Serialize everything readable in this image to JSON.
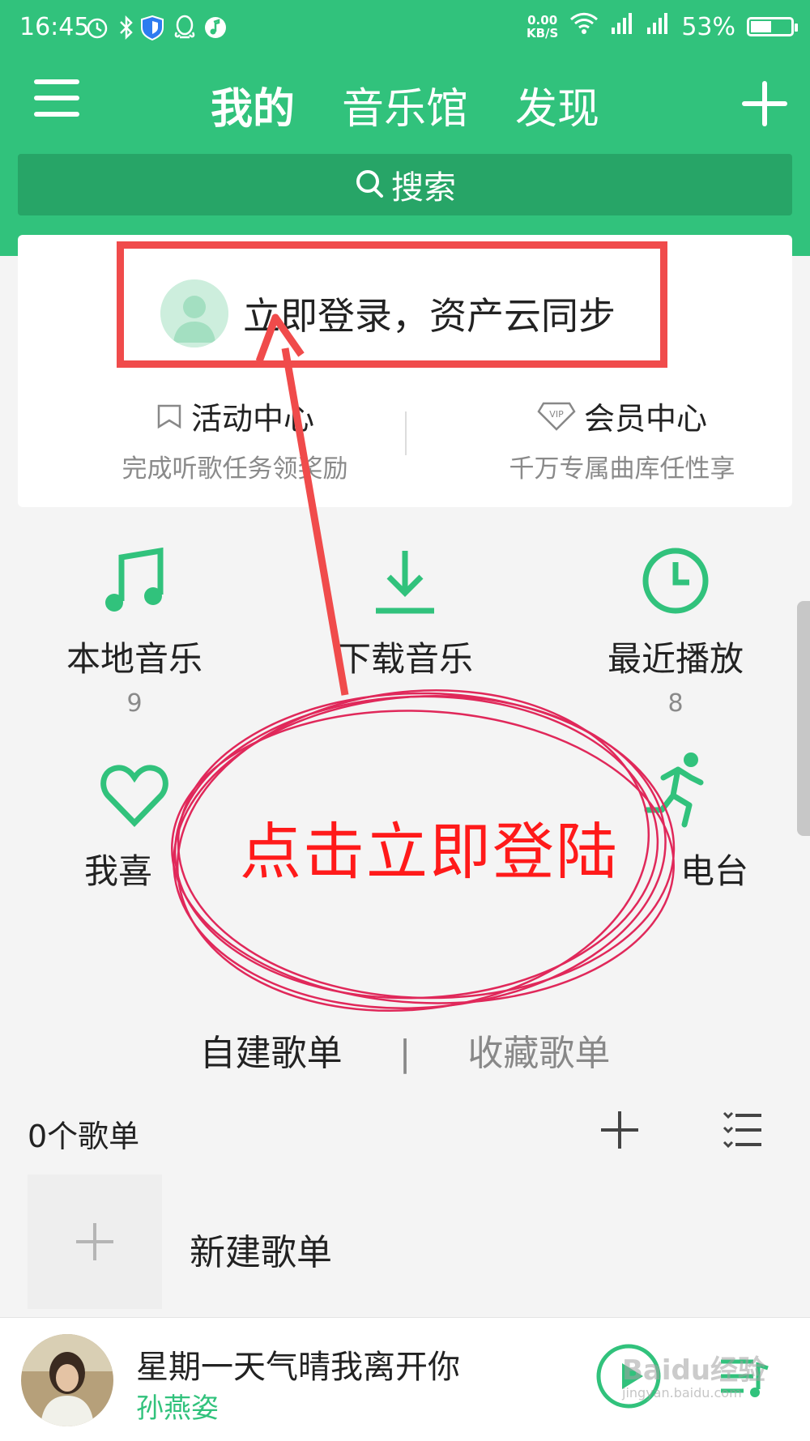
{
  "status_bar": {
    "time": "16:45",
    "net_speed_value": "0.00",
    "net_speed_unit": "KB/S",
    "battery_text": "53%",
    "battery_level": 0.53
  },
  "header": {
    "tabs": [
      {
        "label": "我的",
        "active": true
      },
      {
        "label": "音乐馆",
        "active": false
      },
      {
        "label": "发现",
        "active": false
      }
    ],
    "search_label": "搜索"
  },
  "login_card": {
    "login_text": "立即登录，资产云同步",
    "activity": {
      "title": "活动中心",
      "desc": "完成听歌任务领奖励"
    },
    "vip": {
      "title": "会员中心",
      "desc": "千万专属曲库任性享",
      "badge": "VIP"
    }
  },
  "grid": {
    "local_music": {
      "label": "本地音乐",
      "count": "9"
    },
    "download_music": {
      "label": "下载音乐"
    },
    "recent_play": {
      "label": "最近播放",
      "count": "8"
    },
    "favorites": {
      "label": "我喜"
    },
    "radio": {
      "label": "电台"
    }
  },
  "playlists": {
    "tab_created": "自建歌单",
    "tab_separator": "|",
    "tab_collected": "收藏歌单",
    "count_text": "0个歌单",
    "new_playlist_label": "新建歌单"
  },
  "player": {
    "song_title": "星期一天气晴我离开你",
    "artist": "孙燕姿"
  },
  "annotation": {
    "text": "点击立即登陆"
  },
  "watermark": {
    "text": "Baidu经验",
    "url_text": "jingyan.baidu.com"
  },
  "colors": {
    "brand_green": "#31c27c",
    "annotation_red": "#f04b4b",
    "annotation_text_red": "#ff1a1a",
    "annotation_ellipse": "#e0285a"
  }
}
